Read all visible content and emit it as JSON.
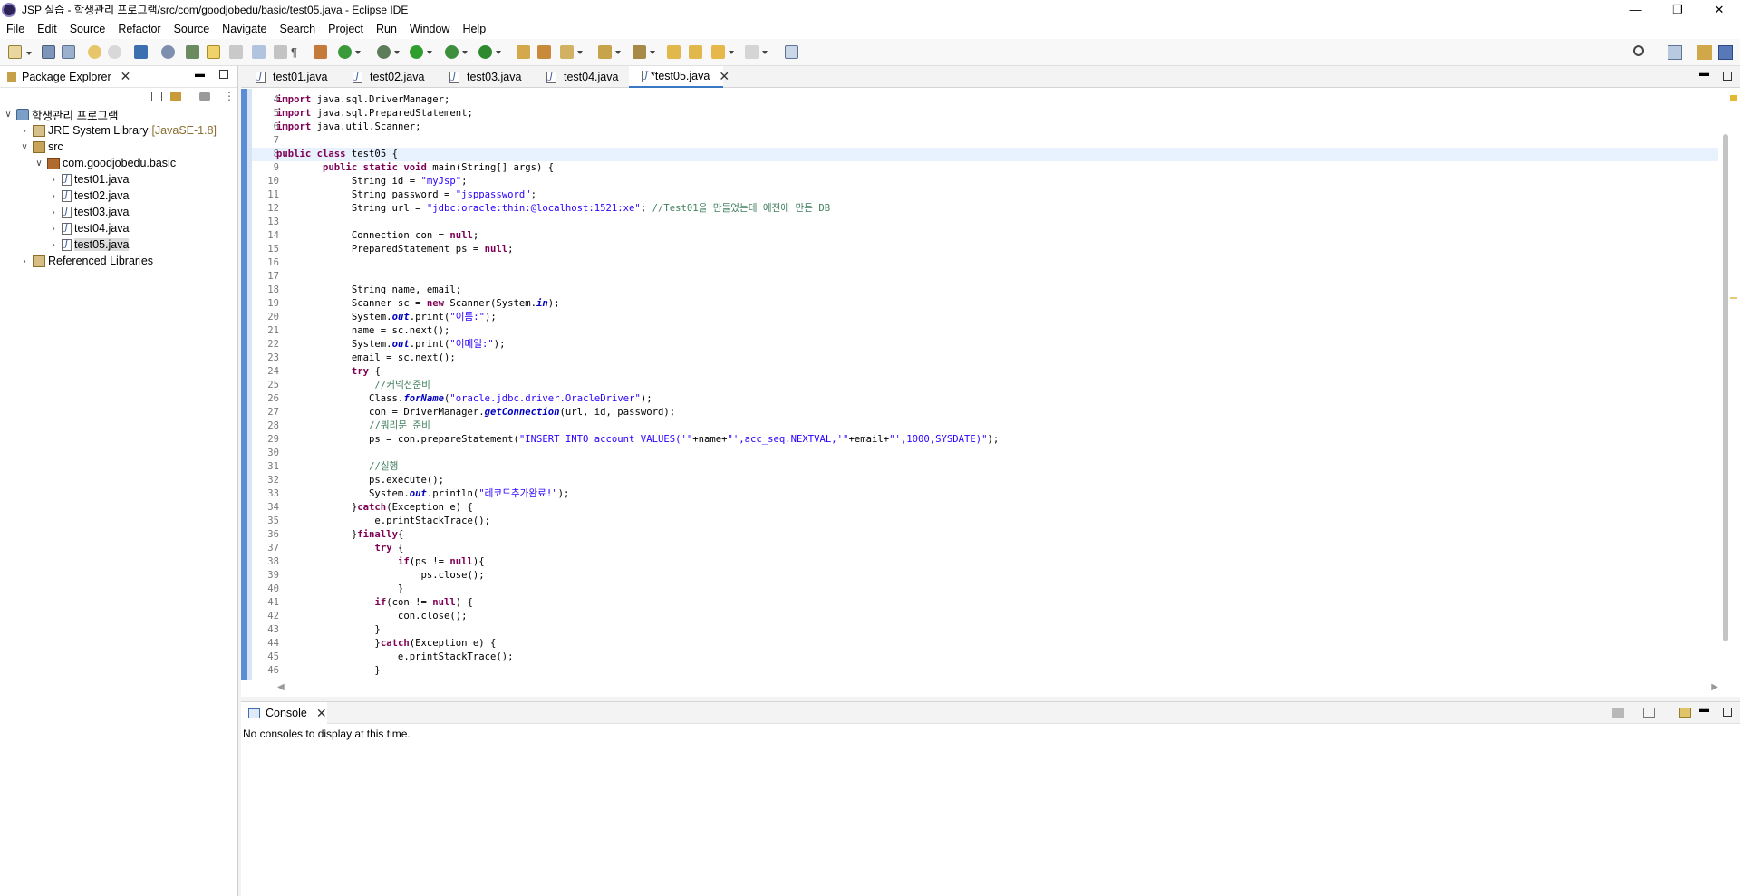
{
  "window": {
    "title": "JSP 실습 - 학생관리 프로그램/src/com/goodjobedu/basic/test05.java - Eclipse IDE"
  },
  "menu": [
    "File",
    "Edit",
    "Source",
    "Refactor",
    "Source",
    "Navigate",
    "Search",
    "Project",
    "Run",
    "Window",
    "Help"
  ],
  "package_explorer": {
    "tab": "Package Explorer",
    "tree": [
      {
        "label": "학생관리 프로그램",
        "kind": "project"
      },
      {
        "label": "JRE System Library",
        "suffix": "[JavaSE-1.8]",
        "kind": "lib"
      },
      {
        "label": "src",
        "kind": "src"
      },
      {
        "label": "com.goodjobedu.basic",
        "kind": "pkg"
      },
      {
        "label": "test01.java",
        "kind": "java"
      },
      {
        "label": "test02.java",
        "kind": "java"
      },
      {
        "label": "test03.java",
        "kind": "java"
      },
      {
        "label": "test04.java",
        "kind": "java"
      },
      {
        "label": "test05.java",
        "kind": "java",
        "selected": true
      },
      {
        "label": "Referenced Libraries",
        "kind": "reflib"
      }
    ]
  },
  "editor": {
    "tabs": [
      "test01.java",
      "test02.java",
      "test03.java",
      "test04.java",
      "*test05.java"
    ],
    "active_tab": 4,
    "line_numbers": [
      "4",
      "5",
      "6",
      "7",
      "8",
      "9",
      "10",
      "11",
      "12",
      "13",
      "14",
      "15",
      "16",
      "17",
      "18",
      "19",
      "20",
      "21",
      "22",
      "23",
      "24",
      "25",
      "26",
      "27",
      "28",
      "29",
      "30",
      "31",
      "32",
      "33",
      "34",
      "35",
      "36",
      "37",
      "38",
      "39",
      "40",
      "41",
      "42",
      "43",
      "44",
      "45",
      "46"
    ],
    "lines": [
      [
        [
          "kw",
          "import"
        ],
        [
          "mt",
          " java.sql.DriverManager;"
        ]
      ],
      [
        [
          "kw",
          "import"
        ],
        [
          "mt",
          " java.sql.PreparedStatement;"
        ]
      ],
      [
        [
          "kw",
          "import"
        ],
        [
          "mt",
          " java.util.Scanner;"
        ]
      ],
      [],
      [
        [
          "kw",
          "public class"
        ],
        [
          "mt",
          " test05 {"
        ]
      ],
      [
        [
          "mt",
          "        "
        ],
        [
          "kw",
          "public static void"
        ],
        [
          "mt",
          " main(String[] args) {"
        ]
      ],
      [
        [
          "mt",
          "             String id = "
        ],
        [
          "st",
          "\"myJsp\""
        ],
        [
          "mt",
          ";"
        ]
      ],
      [
        [
          "mt",
          "             String password = "
        ],
        [
          "st",
          "\"jsppassword\""
        ],
        [
          "mt",
          ";"
        ]
      ],
      [
        [
          "mt",
          "             String url = "
        ],
        [
          "st",
          "\"jdbc:oracle:thin:@localhost:1521:xe\""
        ],
        [
          "mt",
          "; "
        ],
        [
          "cm",
          "//Test01을 만들었는데 예전에 만든 DB"
        ]
      ],
      [],
      [
        [
          "mt",
          "             Connection con = "
        ],
        [
          "kw",
          "null"
        ],
        [
          "mt",
          ";"
        ]
      ],
      [
        [
          "mt",
          "             PreparedStatement ps = "
        ],
        [
          "kw",
          "null"
        ],
        [
          "mt",
          ";"
        ]
      ],
      [],
      [],
      [
        [
          "mt",
          "             String name, email;"
        ]
      ],
      [
        [
          "mt",
          "             Scanner sc = "
        ],
        [
          "kw",
          "new"
        ],
        [
          "mt",
          " Scanner(System."
        ],
        [
          "fd",
          "in"
        ],
        [
          "mt",
          ");"
        ]
      ],
      [
        [
          "mt",
          "             System."
        ],
        [
          "fd",
          "out"
        ],
        [
          "mt",
          ".print("
        ],
        [
          "st",
          "\"이름:\""
        ],
        [
          "mt",
          ");"
        ]
      ],
      [
        [
          "mt",
          "             name = sc.next();"
        ]
      ],
      [
        [
          "mt",
          "             System."
        ],
        [
          "fd",
          "out"
        ],
        [
          "mt",
          ".print("
        ],
        [
          "st",
          "\"이메일:\""
        ],
        [
          "mt",
          ");"
        ]
      ],
      [
        [
          "mt",
          "             email = sc.next();"
        ]
      ],
      [
        [
          "mt",
          "             "
        ],
        [
          "kw",
          "try"
        ],
        [
          "mt",
          " {"
        ]
      ],
      [
        [
          "mt",
          "                 "
        ],
        [
          "cm",
          "//커넥션준비"
        ]
      ],
      [
        [
          "mt",
          "                Class."
        ],
        [
          "fd",
          "forName"
        ],
        [
          "mt",
          "("
        ],
        [
          "st",
          "\"oracle.jdbc.driver.OracleDriver\""
        ],
        [
          "mt",
          ");"
        ]
      ],
      [
        [
          "mt",
          "                con = DriverManager."
        ],
        [
          "fd",
          "getConnection"
        ],
        [
          "mt",
          "(url, id, password);"
        ]
      ],
      [
        [
          "mt",
          "                "
        ],
        [
          "cm",
          "//쿼리문 준비"
        ]
      ],
      [
        [
          "mt",
          "                ps = con.prepareStatement("
        ],
        [
          "st",
          "\"INSERT INTO account VALUES('\""
        ],
        [
          "mt",
          "+name+"
        ],
        [
          "st",
          "\"',acc_seq.NEXTVAL,'\""
        ],
        [
          "mt",
          "+email+"
        ],
        [
          "st",
          "\"',1000,SYSDATE)\""
        ],
        [
          "mt",
          ");"
        ]
      ],
      [],
      [
        [
          "mt",
          "                "
        ],
        [
          "cm",
          "//실행"
        ]
      ],
      [
        [
          "mt",
          "                ps.execute();"
        ]
      ],
      [
        [
          "mt",
          "                System."
        ],
        [
          "fd",
          "out"
        ],
        [
          "mt",
          ".println("
        ],
        [
          "st",
          "\"레코드추가완료!\""
        ],
        [
          "mt",
          ");"
        ]
      ],
      [
        [
          "mt",
          "             }"
        ],
        [
          "kw",
          "catch"
        ],
        [
          "mt",
          "(Exception e) {"
        ]
      ],
      [
        [
          "mt",
          "                 e.printStackTrace();"
        ]
      ],
      [
        [
          "mt",
          "             }"
        ],
        [
          "kw",
          "finally"
        ],
        [
          "mt",
          "{"
        ]
      ],
      [
        [
          "mt",
          "                 "
        ],
        [
          "kw",
          "try"
        ],
        [
          "mt",
          " {"
        ]
      ],
      [
        [
          "mt",
          "                     "
        ],
        [
          "kw",
          "if"
        ],
        [
          "mt",
          "(ps != "
        ],
        [
          "kw",
          "null"
        ],
        [
          "mt",
          "){"
        ]
      ],
      [
        [
          "mt",
          "                         ps.close();"
        ]
      ],
      [
        [
          "mt",
          "                     }"
        ]
      ],
      [
        [
          "mt",
          "                 "
        ],
        [
          "kw",
          "if"
        ],
        [
          "mt",
          "(con != "
        ],
        [
          "kw",
          "null"
        ],
        [
          "mt",
          ") {"
        ]
      ],
      [
        [
          "mt",
          "                     con.close();"
        ]
      ],
      [
        [
          "mt",
          "                 }"
        ]
      ],
      [
        [
          "mt",
          "                 }"
        ],
        [
          "kw",
          "catch"
        ],
        [
          "mt",
          "(Exception e) {"
        ]
      ],
      [
        [
          "mt",
          "                     e.printStackTrace();"
        ]
      ],
      [
        [
          "mt",
          "                 }"
        ]
      ]
    ]
  },
  "console": {
    "tab": "Console",
    "message": "No consoles to display at this time."
  }
}
